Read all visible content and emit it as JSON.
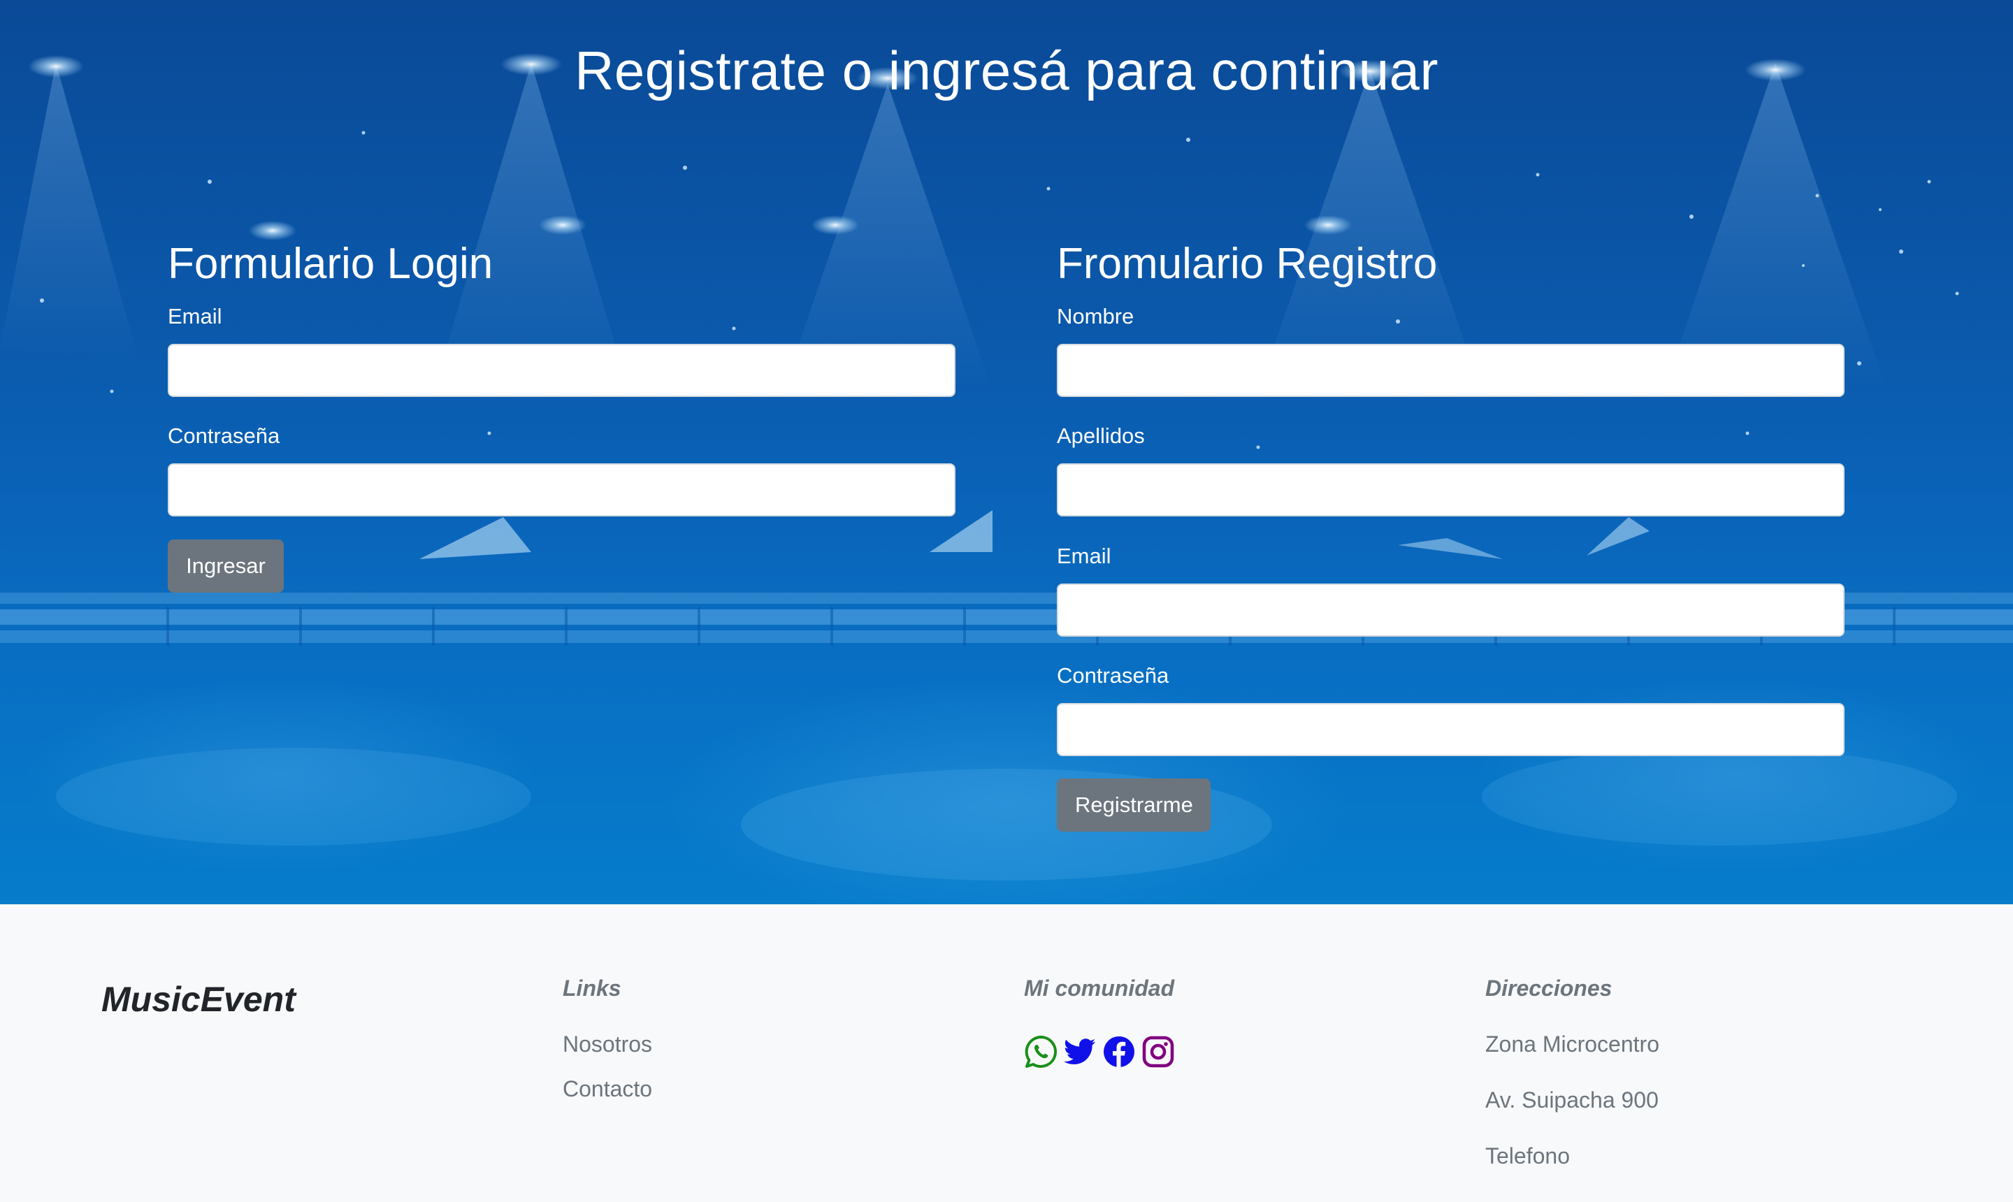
{
  "hero": {
    "title": "Registrate o ingresá para continuar"
  },
  "login_form": {
    "heading": "Formulario Login",
    "email_label": "Email",
    "email_value": "",
    "password_label": "Contraseña",
    "password_value": "",
    "submit_label": "Ingresar"
  },
  "register_form": {
    "heading": "Fromulario Registro",
    "name_label": "Nombre",
    "name_value": "",
    "surname_label": "Apellidos",
    "surname_value": "",
    "email_label": "Email",
    "email_value": "",
    "password_label": "Contraseña",
    "password_value": "",
    "submit_label": "Registrarme"
  },
  "footer": {
    "brand": "MusicEvent",
    "links_heading": "Links",
    "links": [
      "Nosotros",
      "Contacto"
    ],
    "community_heading": "Mi comunidad",
    "social_icons": [
      {
        "icon": "whatsapp-icon",
        "color": "#1a8f1a"
      },
      {
        "icon": "twitter-icon",
        "color": "#1010e8"
      },
      {
        "icon": "facebook-icon",
        "color": "#1010e8"
      },
      {
        "icon": "instagram-icon",
        "color": "#800080"
      }
    ],
    "addresses_heading": "Direcciones",
    "addresses": [
      "Zona Microcentro",
      "Av. Suipacha 900",
      "Telefono"
    ]
  },
  "colors": {
    "hero_background": "#0b5aab",
    "button_background": "#6c757d",
    "footer_background": "#f8f9fa",
    "footer_text": "#6c757d"
  }
}
